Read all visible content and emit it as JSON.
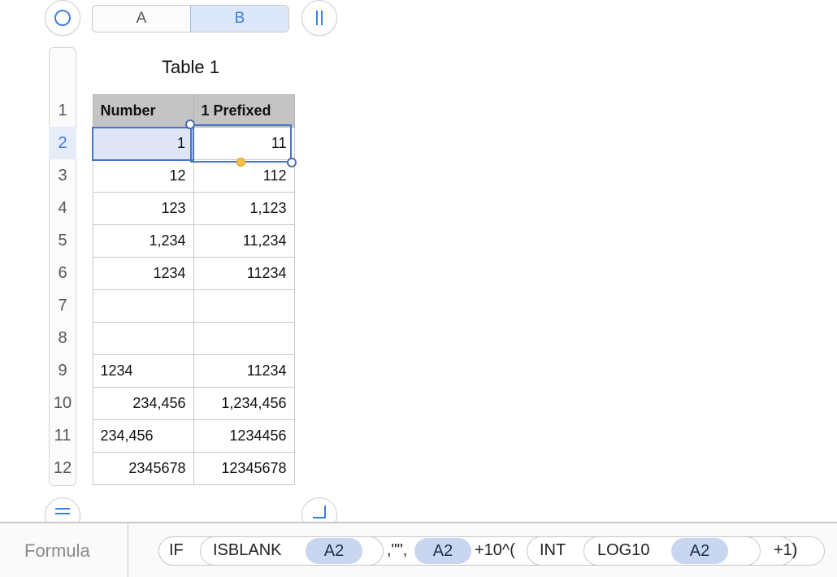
{
  "columns": [
    "A",
    "B"
  ],
  "table": {
    "title": "Table 1",
    "header": [
      "Number",
      "1 Prefixed"
    ],
    "rows": [
      {
        "num": "2",
        "a": "1",
        "b": "11"
      },
      {
        "num": "3",
        "a": "12",
        "b": "112"
      },
      {
        "num": "4",
        "a": "123",
        "b": "1,123"
      },
      {
        "num": "5",
        "a": "1,234",
        "b": "11,234"
      },
      {
        "num": "6",
        "a": "1234",
        "b": "11234"
      },
      {
        "num": "7",
        "a": "",
        "b": ""
      },
      {
        "num": "8",
        "a": "",
        "b": ""
      },
      {
        "num": "9",
        "a": "1234",
        "b": "11234"
      },
      {
        "num": "10",
        "a": "234,456",
        "b": "1,234,456"
      },
      {
        "num": "11",
        "a": "234,456",
        "b": "1234456"
      },
      {
        "num": "12",
        "a": "2345678",
        "b": "12345678"
      }
    ],
    "header_row_num": "1"
  },
  "formula": {
    "label": "Formula",
    "fn_if": "IF",
    "fn_isblank": "ISBLANK",
    "ref1": "A2",
    "sep1": ",\"\",",
    "ref2": "A2",
    "plus_pow": "+10^(",
    "fn_int": "INT",
    "fn_log10": "LOG10",
    "ref3": "A2",
    "tail": "+1)"
  },
  "colors": {
    "accent": "#3d7fe0",
    "selection": "#4a73c5",
    "header_fill": "#c4c4c4"
  },
  "icons": [
    "circle-select-icon",
    "freeze-columns-icon",
    "add-row-icon",
    "add-column-icon"
  ]
}
